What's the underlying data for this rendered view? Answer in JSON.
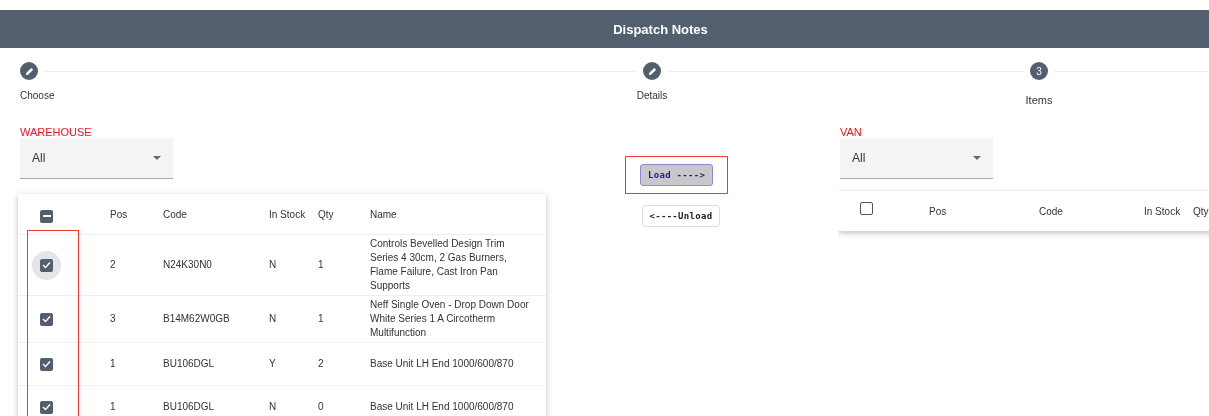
{
  "header": {
    "title": "Dispatch Notes"
  },
  "stepper": [
    {
      "label": "Choose",
      "kind": "done"
    },
    {
      "label": "Details",
      "kind": "done"
    },
    {
      "label": "Items",
      "kind": "current",
      "icon_text": "3"
    }
  ],
  "warehouse": {
    "label": "WAREHOUSE",
    "select_value": "All",
    "rows_highlighted": true,
    "table": {
      "columns": [
        "Pos",
        "Code",
        "In Stock",
        "Qty",
        "Name"
      ],
      "header_indeterminate": true,
      "rows": [
        {
          "checked": true,
          "focused": true,
          "cells": [
            "2",
            "N24K30N0",
            "N",
            "1",
            "Controls Bevelled Design Trim Series 4 30cm, 2 Gas Burners, Flame Failure, Cast Iron Pan Supports"
          ]
        },
        {
          "checked": true,
          "focused": false,
          "cells": [
            "3",
            "B14M62W0GB",
            "N",
            "1",
            "Neff Single Oven - Drop Down Door White Series 1 A Circotherm Multifunction"
          ]
        },
        {
          "checked": true,
          "focused": false,
          "cells": [
            "1",
            "BU106DGL",
            "Y",
            "2",
            "Base Unit LH End 1000/600/870"
          ]
        },
        {
          "checked": true,
          "focused": false,
          "cells": [
            "1",
            "BU106DGL",
            "N",
            "0",
            "Base Unit LH End 1000/600/870"
          ]
        }
      ]
    }
  },
  "actions": [
    {
      "label": "Load ---->",
      "kind": "primary",
      "highlighted": true
    },
    {
      "label": "<----Unload",
      "kind": "plain",
      "highlighted": false
    }
  ],
  "van": {
    "label": "VAN",
    "select_value": "All",
    "table": {
      "columns": [
        "Pos",
        "Code",
        "In Stock",
        "Qty"
      ],
      "header_indeterminate": false
    }
  }
}
